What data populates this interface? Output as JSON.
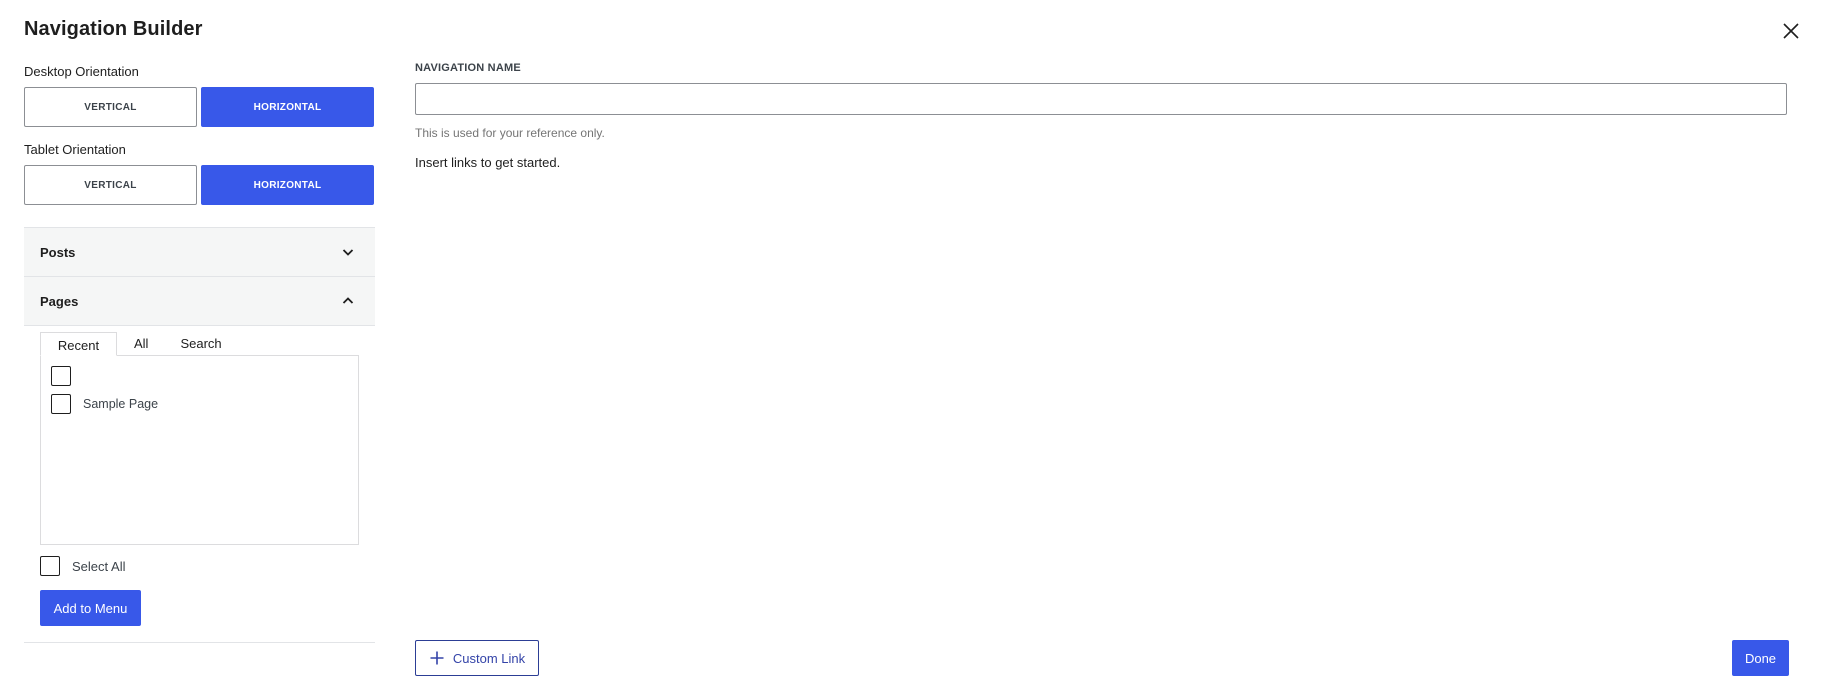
{
  "header": {
    "title": "Navigation Builder",
    "close_icon": "close-icon"
  },
  "orientation": {
    "desktop": {
      "label": "Desktop Orientation",
      "options": [
        "VERTICAL",
        "HORIZONTAL"
      ],
      "selected": "HORIZONTAL"
    },
    "tablet": {
      "label": "Tablet Orientation",
      "options": [
        "VERTICAL",
        "HORIZONTAL"
      ],
      "selected": "HORIZONTAL"
    }
  },
  "panels": [
    {
      "label": "Posts",
      "expanded": false,
      "icon": "chevron-down-icon"
    },
    {
      "label": "Pages",
      "expanded": true,
      "icon": "chevron-up-icon"
    }
  ],
  "pages_panel": {
    "tabs": [
      "Recent",
      "All",
      "Search"
    ],
    "active_tab": "Recent",
    "items": [
      {
        "label": "",
        "checked": false
      },
      {
        "label": "Sample Page",
        "checked": false
      }
    ],
    "select_all_label": "Select All",
    "add_button_label": "Add to Menu"
  },
  "main": {
    "name_field_label": "NAVIGATION NAME",
    "name_field_value": "",
    "name_field_placeholder": "",
    "help_text": "This is used for your reference only.",
    "empty_hint": "Insert links to get started."
  },
  "footer": {
    "custom_link_label": "Custom Link",
    "custom_link_icon": "plus-icon",
    "done_label": "Done"
  },
  "colors": {
    "accent": "#3858e9",
    "panel_bg": "#f5f6f6",
    "text": "#1e1e1e",
    "muted": "#757575"
  }
}
